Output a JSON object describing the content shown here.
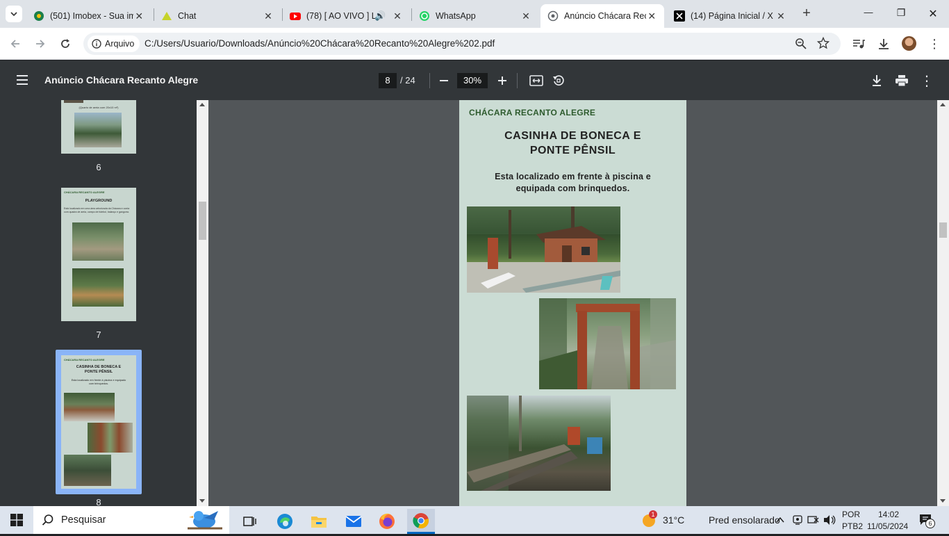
{
  "tabs": [
    {
      "title": "(501) Imobex - Sua im",
      "icon": "imobex-icon",
      "close": "✕"
    },
    {
      "title": "Chat",
      "icon": "chat-icon",
      "close": "✕"
    },
    {
      "title": "(78) [ AO VIVO ] L",
      "icon": "youtube-icon",
      "close": "✕"
    },
    {
      "title": "WhatsApp",
      "icon": "whatsapp-icon",
      "close": "✕"
    },
    {
      "title": "Anúncio Chácara Rec",
      "icon": "globe-icon",
      "close": "✕"
    },
    {
      "title": "(14) Página Inicial / X",
      "icon": "x-icon",
      "close": "✕"
    }
  ],
  "window": {
    "minimize": "—",
    "restore": "❐",
    "close": "✕"
  },
  "address": {
    "chip_label": "Arquivo",
    "url": "C:/Users/Usuario/Downloads/Anúncio%20Chácara%20Recanto%20Alegre%202.pdf"
  },
  "pdf": {
    "title": "Anúncio Chácara Recanto Alegre",
    "current_page": "8",
    "total_pages": "/ 24",
    "zoom": "30%"
  },
  "thumbnails": [
    {
      "number": "6",
      "caption": "(Quarto de areia com 20x10 m²)"
    },
    {
      "number": "7",
      "header": "CHÁCARA RECANTO ALEGRE",
      "title": "PLAYGROUND",
      "text": "Está localizado em uma área arborizada da Chácara e conta com quadra de areia, campo de futebol, balanço e gangorra."
    },
    {
      "number": "8",
      "header": "CHÁCARA RECANTO ALEGRE",
      "title": "CASINHA DE BONECA E PONTE PÊNSIL",
      "text": "Esta localizado em frente à piscina e equipado com brinquedos."
    }
  ],
  "page_content": {
    "header": "CHÁCARA RECANTO ALEGRE",
    "title_line1": "CASINHA DE BONECA E",
    "title_line2": "PONTE PÊNSIL",
    "desc_line1": "Esta localizado em frente à piscina e",
    "desc_line2": "equipada com brinquedos."
  },
  "taskbar": {
    "search_placeholder": "Pesquisar",
    "weather_temp": "31°C",
    "weather_text": "Pred ensolarado",
    "weather_badge": "1",
    "lang_top": "POR",
    "lang_bottom": "PTB2",
    "time": "14:02",
    "date": "11/05/2024",
    "notif_count": "6"
  },
  "colors": {
    "page_bg": "#cbdcd4",
    "header_green": "#2e5b2e",
    "selected_thumb": "#8ab4f8"
  }
}
